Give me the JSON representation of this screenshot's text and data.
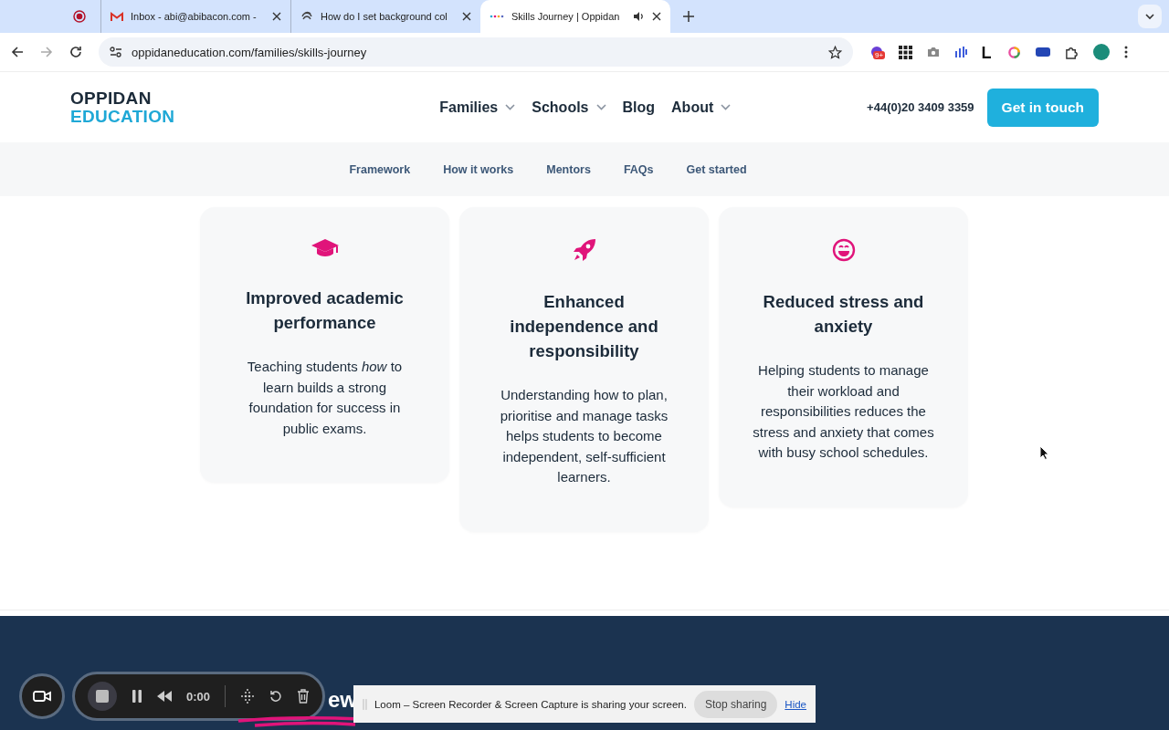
{
  "browser": {
    "tabs": [
      {
        "title": "Inbox - abi@abibacon.com -",
        "kind": "mail",
        "selected": false
      },
      {
        "title": "How do I set background col",
        "kind": "swirl",
        "selected": false
      },
      {
        "title": "Skills Journey | Oppidan",
        "kind": "dots",
        "selected": true,
        "audio": true
      }
    ],
    "url": "oppidaneducation.com/families/skills-journey",
    "extension_badge": "9+"
  },
  "site": {
    "logo": [
      "OPPIDAN",
      "EDUCATION"
    ],
    "nav": [
      {
        "label": "Families",
        "dropdown": true
      },
      {
        "label": "Schools",
        "dropdown": true
      },
      {
        "label": "Blog",
        "dropdown": false
      },
      {
        "label": "About",
        "dropdown": true
      }
    ],
    "phone": "+44(0)20 3409 3359",
    "cta": "Get in touch",
    "subnav": [
      "Framework",
      "How it works",
      "Mentors",
      "FAQs",
      "Get started"
    ]
  },
  "cards": [
    {
      "kind": "cap",
      "title": "Improved academic performance",
      "body": "Teaching students *how* to learn builds a strong foundation for success in public exams."
    },
    {
      "kind": "rocket",
      "title": "Enhanced independence and responsibility",
      "body": "Understanding how to plan, prioritise and manage tasks helps students to become independent, self-sufficient learners."
    },
    {
      "kind": "smile",
      "title": "Reduced stress and anxiety",
      "body": "Helping students to manage their workload and responsibilities reduces the stress and anxiety that comes with busy school schedules."
    }
  ],
  "band_heading": "ew",
  "recorder": {
    "time": "0:00"
  },
  "share_bar": {
    "message": "Loom – Screen Recorder & Screen Capture is sharing your screen.",
    "stop": "Stop sharing",
    "hide": "Hide"
  }
}
